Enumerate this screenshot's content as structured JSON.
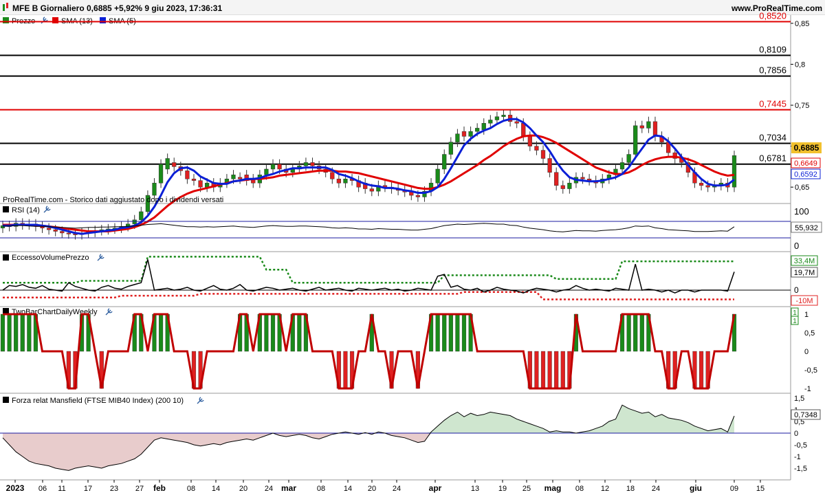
{
  "header": {
    "title": "MFE B Giornaliero 0,6885 +5,92% 9 giu 2023, 17:36:31",
    "site": "www.ProRealTime.com"
  },
  "legend": {
    "prezzo": "Prezzo",
    "sma13": "SMA (13)",
    "sma5": "SMA (5)",
    "notice": "ProRealTime.com - Storico dati aggiustato dopo i dividendi versati"
  },
  "axis_labels": {
    "main": [
      "0,85",
      "0,8",
      "0,75",
      "0,7",
      "0,65"
    ],
    "rsi_top": "100",
    "rsi_bottom": "0",
    "evp": "0",
    "twobar": [
      "1",
      "0,5",
      "0",
      "-0,5",
      "-1"
    ],
    "mansfield": [
      "1,5",
      "1",
      "0,5",
      "0",
      "-0,5",
      "-1",
      "-1,5"
    ]
  },
  "levels": [
    {
      "value": "0,8520",
      "color": "#e00000"
    },
    {
      "value": "0,8109",
      "color": "#000000"
    },
    {
      "value": "0,7856",
      "color": "#000000"
    },
    {
      "value": "0,7445",
      "color": "#e00000"
    },
    {
      "value": "0,7034",
      "color": "#000000"
    },
    {
      "value": "0,6781",
      "color": "#000000"
    }
  ],
  "price_tags": {
    "last": "0,6885",
    "sma13": "0,6649",
    "sma5": "0,6592"
  },
  "panels": {
    "rsi": {
      "title": "RSI (14)",
      "value": "55,932"
    },
    "evp": {
      "title": "EccessoVolumePrezzo",
      "upper": "33,4M",
      "last": "19,7M",
      "lower": "-10M"
    },
    "twobar": {
      "title": "TwoBarChartDailyWeekly",
      "v1": "1",
      "v2": "1"
    },
    "mansfield": {
      "title": "Forza relat Mansfield (FTSE MIB40 Index) (200 10)",
      "value": "0,7348"
    }
  },
  "xaxis": [
    "2023",
    "06",
    "11",
    "17",
    "23",
    "27",
    "feb",
    "08",
    "14",
    "20",
    "24",
    "mar",
    "08",
    "14",
    "20",
    "24",
    "apr",
    "13",
    "19",
    "25",
    "mag",
    "08",
    "12",
    "18",
    "24",
    "giu",
    "09",
    "15"
  ],
  "colors": {
    "up": "#1a8a1a",
    "down": "#e02020",
    "sma13": "#e00000",
    "sma5": "#0a1fd6",
    "tag_last": "#f2c12e"
  },
  "chart_data": {
    "type": "candlestick",
    "title": "MFE B Giornaliero",
    "ylim": [
      0.63,
      0.86
    ],
    "dates": [
      "2023-01-02",
      "2023-01-03",
      "2023-01-04",
      "2023-01-05",
      "2023-01-06",
      "2023-01-09",
      "2023-01-10",
      "2023-01-11",
      "2023-01-12",
      "2023-01-13",
      "2023-01-16",
      "2023-01-17",
      "2023-01-18",
      "2023-01-19",
      "2023-01-20",
      "2023-01-23",
      "2023-01-24",
      "2023-01-25",
      "2023-01-26",
      "2023-01-27",
      "2023-01-30",
      "2023-01-31",
      "2023-02-01",
      "2023-02-02",
      "2023-02-03",
      "2023-02-06",
      "2023-02-07",
      "2023-02-08",
      "2023-02-09",
      "2023-02-10",
      "2023-02-13",
      "2023-02-14",
      "2023-02-15",
      "2023-02-16",
      "2023-02-17",
      "2023-02-20",
      "2023-02-21",
      "2023-02-22",
      "2023-02-23",
      "2023-02-24",
      "2023-02-27",
      "2023-02-28",
      "2023-03-01",
      "2023-03-02",
      "2023-03-03",
      "2023-03-06",
      "2023-03-07",
      "2023-03-08",
      "2023-03-09",
      "2023-03-10",
      "2023-03-13",
      "2023-03-14",
      "2023-03-15",
      "2023-03-16",
      "2023-03-17",
      "2023-03-20",
      "2023-03-21",
      "2023-03-22",
      "2023-03-23",
      "2023-03-24",
      "2023-03-27",
      "2023-03-28",
      "2023-03-29",
      "2023-03-30",
      "2023-03-31",
      "2023-04-03",
      "2023-04-04",
      "2023-04-05",
      "2023-04-06",
      "2023-04-11",
      "2023-04-12",
      "2023-04-13",
      "2023-04-14",
      "2023-04-17",
      "2023-04-18",
      "2023-04-19",
      "2023-04-20",
      "2023-04-21",
      "2023-04-24",
      "2023-04-25",
      "2023-04-26",
      "2023-04-27",
      "2023-04-28",
      "2023-05-02",
      "2023-05-03",
      "2023-05-04",
      "2023-05-05",
      "2023-05-08",
      "2023-05-09",
      "2023-05-10",
      "2023-05-11",
      "2023-05-12",
      "2023-05-15",
      "2023-05-16",
      "2023-05-17",
      "2023-05-18",
      "2023-05-19",
      "2023-05-22",
      "2023-05-23",
      "2023-05-24",
      "2023-05-25",
      "2023-05-26",
      "2023-05-29",
      "2023-05-30",
      "2023-05-31",
      "2023-06-01",
      "2023-06-02",
      "2023-06-05",
      "2023-06-06",
      "2023-06-07",
      "2023-06-08",
      "2023-06-09"
    ],
    "open": [
      0.6,
      0.603,
      0.602,
      0.606,
      0.604,
      0.605,
      0.602,
      0.6,
      0.598,
      0.596,
      0.594,
      0.593,
      0.592,
      0.594,
      0.595,
      0.597,
      0.598,
      0.599,
      0.6,
      0.602,
      0.605,
      0.61,
      0.62,
      0.64,
      0.655,
      0.672,
      0.68,
      0.675,
      0.67,
      0.66,
      0.658,
      0.65,
      0.655,
      0.65,
      0.655,
      0.66,
      0.662,
      0.665,
      0.66,
      0.655,
      0.665,
      0.672,
      0.678,
      0.672,
      0.668,
      0.672,
      0.676,
      0.68,
      0.676,
      0.672,
      0.668,
      0.66,
      0.655,
      0.66,
      0.658,
      0.655,
      0.648,
      0.645,
      0.652,
      0.65,
      0.648,
      0.646,
      0.644,
      0.64,
      0.638,
      0.645,
      0.655,
      0.672,
      0.69,
      0.705,
      0.718,
      0.712,
      0.718,
      0.72,
      0.728,
      0.732,
      0.736,
      0.738,
      0.73,
      0.728,
      0.712,
      0.7,
      0.695,
      0.685,
      0.668,
      0.652,
      0.648,
      0.655,
      0.662,
      0.66,
      0.658,
      0.655,
      0.66,
      0.665,
      0.672,
      0.68,
      0.69,
      0.725,
      0.722,
      0.73,
      0.712,
      0.705,
      0.692,
      0.685,
      0.68,
      0.668,
      0.655,
      0.652,
      0.65,
      0.652,
      0.655,
      0.65
    ],
    "close": [
      0.603,
      0.602,
      0.606,
      0.604,
      0.605,
      0.602,
      0.6,
      0.598,
      0.596,
      0.594,
      0.593,
      0.592,
      0.594,
      0.595,
      0.597,
      0.598,
      0.599,
      0.6,
      0.602,
      0.605,
      0.61,
      0.62,
      0.64,
      0.655,
      0.678,
      0.685,
      0.675,
      0.67,
      0.66,
      0.658,
      0.65,
      0.655,
      0.65,
      0.655,
      0.66,
      0.665,
      0.66,
      0.658,
      0.655,
      0.665,
      0.672,
      0.678,
      0.672,
      0.668,
      0.672,
      0.676,
      0.68,
      0.676,
      0.672,
      0.668,
      0.66,
      0.655,
      0.66,
      0.658,
      0.65,
      0.648,
      0.645,
      0.652,
      0.65,
      0.648,
      0.646,
      0.644,
      0.64,
      0.638,
      0.645,
      0.655,
      0.672,
      0.69,
      0.705,
      0.715,
      0.712,
      0.718,
      0.722,
      0.728,
      0.732,
      0.736,
      0.738,
      0.73,
      0.728,
      0.712,
      0.7,
      0.695,
      0.685,
      0.668,
      0.652,
      0.648,
      0.655,
      0.662,
      0.66,
      0.658,
      0.655,
      0.66,
      0.665,
      0.672,
      0.68,
      0.69,
      0.725,
      0.722,
      0.73,
      0.712,
      0.705,
      0.692,
      0.685,
      0.68,
      0.668,
      0.655,
      0.652,
      0.65,
      0.652,
      0.655,
      0.65,
      0.6885
    ],
    "sma13": [
      0.604,
      0.604,
      0.604,
      0.604,
      0.604,
      0.603,
      0.603,
      0.602,
      0.601,
      0.6,
      0.599,
      0.598,
      0.597,
      0.596,
      0.596,
      0.596,
      0.596,
      0.597,
      0.598,
      0.599,
      0.601,
      0.604,
      0.608,
      0.613,
      0.62,
      0.627,
      0.633,
      0.638,
      0.642,
      0.645,
      0.647,
      0.649,
      0.651,
      0.653,
      0.655,
      0.657,
      0.658,
      0.659,
      0.66,
      0.66,
      0.661,
      0.662,
      0.664,
      0.665,
      0.666,
      0.667,
      0.668,
      0.669,
      0.67,
      0.67,
      0.67,
      0.669,
      0.669,
      0.668,
      0.667,
      0.665,
      0.663,
      0.661,
      0.659,
      0.657,
      0.655,
      0.653,
      0.651,
      0.649,
      0.648,
      0.648,
      0.65,
      0.653,
      0.657,
      0.662,
      0.667,
      0.672,
      0.677,
      0.683,
      0.688,
      0.694,
      0.7,
      0.705,
      0.709,
      0.712,
      0.713,
      0.713,
      0.711,
      0.708,
      0.704,
      0.699,
      0.694,
      0.689,
      0.684,
      0.679,
      0.674,
      0.671,
      0.668,
      0.666,
      0.666,
      0.668,
      0.672,
      0.677,
      0.681,
      0.684,
      0.686,
      0.687,
      0.687,
      0.686,
      0.684,
      0.681,
      0.677,
      0.673,
      0.669,
      0.666,
      0.664,
      0.6649
    ],
    "sma5": [
      0.603,
      0.603,
      0.604,
      0.604,
      0.604,
      0.604,
      0.603,
      0.602,
      0.6,
      0.598,
      0.596,
      0.594,
      0.593,
      0.594,
      0.595,
      0.596,
      0.597,
      0.598,
      0.6,
      0.601,
      0.603,
      0.607,
      0.615,
      0.626,
      0.64,
      0.656,
      0.667,
      0.673,
      0.674,
      0.67,
      0.663,
      0.659,
      0.655,
      0.654,
      0.654,
      0.657,
      0.658,
      0.66,
      0.66,
      0.661,
      0.664,
      0.666,
      0.669,
      0.671,
      0.673,
      0.673,
      0.674,
      0.674,
      0.674,
      0.674,
      0.671,
      0.666,
      0.664,
      0.661,
      0.657,
      0.654,
      0.652,
      0.651,
      0.649,
      0.649,
      0.648,
      0.646,
      0.645,
      0.643,
      0.643,
      0.645,
      0.65,
      0.66,
      0.673,
      0.687,
      0.701,
      0.709,
      0.715,
      0.719,
      0.722,
      0.727,
      0.731,
      0.733,
      0.733,
      0.729,
      0.722,
      0.713,
      0.705,
      0.694,
      0.681,
      0.67,
      0.662,
      0.659,
      0.658,
      0.657,
      0.657,
      0.658,
      0.66,
      0.662,
      0.666,
      0.674,
      0.686,
      0.697,
      0.708,
      0.713,
      0.712,
      0.706,
      0.697,
      0.687,
      0.677,
      0.668,
      0.66,
      0.654,
      0.652,
      0.652,
      0.653,
      0.6592
    ],
    "rsi": [
      58,
      58,
      59,
      59,
      58,
      57,
      57,
      56,
      55,
      54,
      53,
      52,
      53,
      54,
      54,
      55,
      55,
      56,
      56,
      57,
      58,
      60,
      62,
      63,
      64,
      62,
      60,
      58,
      56,
      56,
      55,
      56,
      55,
      56,
      57,
      58,
      56,
      55,
      54,
      56,
      58,
      59,
      58,
      57,
      57,
      58,
      58,
      57,
      56,
      55,
      53,
      52,
      53,
      52,
      50,
      50,
      49,
      51,
      50,
      49,
      49,
      48,
      47,
      47,
      49,
      51,
      55,
      59,
      61,
      63,
      62,
      63,
      64,
      65,
      64,
      63,
      63,
      60,
      59,
      55,
      52,
      50,
      48,
      45,
      43,
      42,
      44,
      46,
      45,
      45,
      44,
      46,
      47,
      48,
      50,
      53,
      58,
      57,
      58,
      53,
      51,
      48,
      47,
      46,
      45,
      43,
      43,
      43,
      44,
      45,
      44,
      55.932
    ],
    "evp": [
      0,
      5,
      4,
      6,
      3,
      2,
      5,
      1,
      0,
      -1,
      8,
      4,
      2,
      0,
      -1,
      3,
      5,
      2,
      1,
      4,
      6,
      8,
      33,
      0,
      1,
      2,
      0,
      1,
      3,
      0,
      -1,
      2,
      5,
      1,
      0,
      2,
      6,
      0,
      -1,
      1,
      3,
      2,
      0,
      1,
      2,
      0,
      -1,
      1,
      3,
      0,
      1,
      2,
      0,
      -1,
      2,
      1,
      0,
      1,
      2,
      0,
      1,
      -1,
      0,
      2,
      1,
      0,
      15,
      17,
      3,
      5,
      1,
      0,
      2,
      -2,
      0,
      3,
      1,
      0,
      -1,
      -3,
      0,
      2,
      1,
      0,
      -2,
      0,
      1,
      5,
      2,
      0,
      1,
      0,
      -1,
      2,
      1,
      0,
      28,
      0,
      1,
      0,
      -2,
      0,
      -3,
      0,
      0,
      -2,
      0,
      0,
      0,
      0,
      -1,
      19.7
    ],
    "twobar": [
      1,
      1,
      1,
      1,
      1,
      1,
      0,
      0,
      0,
      0,
      -1,
      -1,
      1,
      1,
      0,
      -1,
      0,
      0,
      0,
      0,
      1,
      1,
      0,
      1,
      1,
      1,
      0,
      0,
      0,
      -1,
      -1,
      0,
      0,
      0,
      0,
      0,
      1,
      1,
      0,
      1,
      1,
      1,
      1,
      0,
      1,
      1,
      1,
      0,
      0,
      0,
      0,
      -1,
      -1,
      -1,
      0,
      0,
      1,
      0,
      0,
      -1,
      0,
      0,
      0,
      -1,
      0,
      1,
      1,
      1,
      1,
      1,
      1,
      1,
      0,
      0,
      0,
      0,
      0,
      0,
      0,
      0,
      -1,
      -1,
      -1,
      -1,
      -1,
      -1,
      -1,
      1,
      0,
      0,
      0,
      0,
      0,
      0,
      1,
      1,
      1,
      1,
      1,
      0,
      0,
      -1,
      -1,
      0,
      0,
      -1,
      -1,
      -1,
      0,
      0,
      0,
      1
    ],
    "mansfield": [
      -0.2,
      -0.5,
      -0.8,
      -1.0,
      -1.2,
      -1.3,
      -1.35,
      -1.4,
      -1.5,
      -1.55,
      -1.6,
      -1.5,
      -1.45,
      -1.4,
      -1.45,
      -1.5,
      -1.4,
      -1.35,
      -1.3,
      -1.2,
      -1.1,
      -0.9,
      -0.6,
      -0.3,
      -0.2,
      -0.25,
      -0.3,
      -0.35,
      -0.4,
      -0.5,
      -0.55,
      -0.5,
      -0.45,
      -0.5,
      -0.4,
      -0.35,
      -0.3,
      -0.25,
      -0.3,
      -0.2,
      -0.1,
      0.0,
      -0.1,
      -0.15,
      -0.1,
      -0.05,
      -0.1,
      -0.2,
      -0.25,
      -0.15,
      -0.05,
      0.0,
      0.05,
      0.0,
      -0.05,
      0.02,
      -0.05,
      0.05,
      0.0,
      -0.1,
      -0.15,
      -0.2,
      -0.3,
      -0.4,
      -0.35,
      0.05,
      0.3,
      0.55,
      0.75,
      0.9,
      0.7,
      0.85,
      0.75,
      0.8,
      0.9,
      0.85,
      0.8,
      0.75,
      0.6,
      0.5,
      0.4,
      0.3,
      0.2,
      0.05,
      0.1,
      0.05,
      0.05,
      0.0,
      0.05,
      0.1,
      0.2,
      0.3,
      0.5,
      0.6,
      1.2,
      1.05,
      0.95,
      0.85,
      0.9,
      0.7,
      0.8,
      0.65,
      0.6,
      0.55,
      0.45,
      0.3,
      0.2,
      0.1,
      0.15,
      0.2,
      0.05,
      0.7348
    ]
  }
}
